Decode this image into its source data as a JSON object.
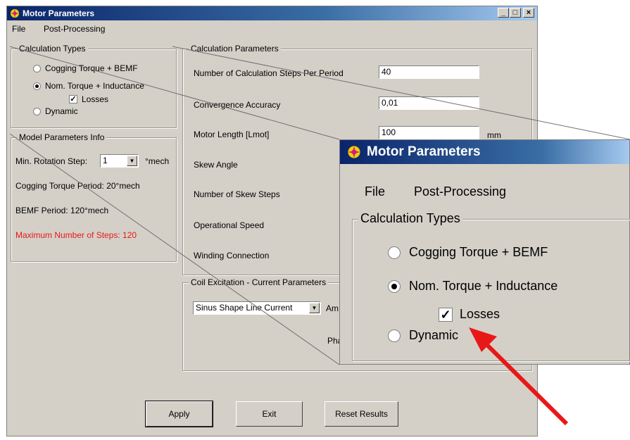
{
  "window": {
    "title": "Motor Parameters",
    "controls": {
      "minimize": "_",
      "maximize": "□",
      "close": "×"
    }
  },
  "menu": [
    "File",
    "Post-Processing"
  ],
  "calc_types": {
    "label": "Calculation Types",
    "options": [
      "Cogging Torque + BEMF",
      "Nom. Torque + Inductance",
      "Dynamic"
    ],
    "selected": "Nom. Torque + Inductance",
    "losses_label": "Losses",
    "losses_checked": true
  },
  "model_info": {
    "label": "Model Parameters Info",
    "min_rotation_label": "Min. Rotation Step:",
    "min_rotation_value": "1",
    "min_rotation_unit": "°mech",
    "cogging_period": "Cogging Torque Period: 20°mech",
    "bemf_period": "BEMF Period: 120°mech",
    "max_steps": "Maximum Number of Steps: 120"
  },
  "calc_params": {
    "label": "Calculation Parameters",
    "steps_label": "Number of Calculation Steps Per Period",
    "steps_value": "40",
    "convergence_label": "Convergence Accuracy",
    "convergence_value": "0,01",
    "length_label": "Motor Length [Lmot]",
    "length_value": "100",
    "length_unit": "mm",
    "skew_angle_label": "Skew Angle",
    "skew_steps_label": "Number of Skew Steps",
    "speed_label": "Operational Speed",
    "winding_label": "Winding Connection"
  },
  "coil": {
    "label": "Coil Excitation - Current Parameters",
    "shape_value": "Sinus Shape Line Current",
    "amp_partial": "Am",
    "phase_partial": "Pha"
  },
  "buttons": {
    "apply": "Apply",
    "exit": "Exit",
    "reset": "Reset Results"
  },
  "zoom": {
    "title": "Motor Parameters",
    "menu": [
      "File",
      "Post-Processing"
    ],
    "group_label": "Calculation Types",
    "options": [
      "Cogging Torque + BEMF",
      "Nom. Torque + Inductance",
      "Dynamic"
    ],
    "losses_label": "Losses"
  },
  "colors": {
    "warning_text": "#e81818",
    "arrow": "#e81818",
    "titlebar": "#0a246a"
  }
}
